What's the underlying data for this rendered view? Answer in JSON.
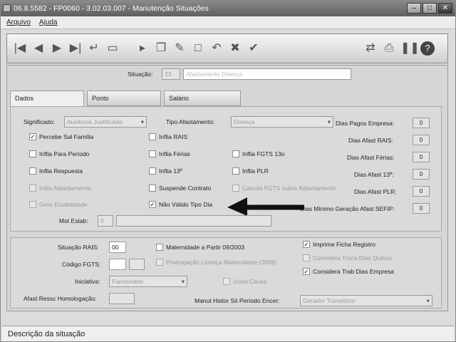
{
  "window": {
    "title": "06.8.5582 - FP0060 - 3.02.03.007 - Manutenção Situações",
    "min": "–",
    "max": "□",
    "close": "✕"
  },
  "menu": {
    "file": "Arquivo",
    "help": "Ajuda"
  },
  "header": {
    "situacao_label": "Situação:",
    "situacao_code": "23",
    "situacao_desc": "Afastamento Doença"
  },
  "tabs": [
    {
      "label": "Dados"
    },
    {
      "label": "Ponto"
    },
    {
      "label": "Salário"
    }
  ],
  "dados": {
    "significado_label": "Significado:",
    "significado_value": "Ausência Justificada",
    "tipo_afast_label": "Tipo Afastamento:",
    "tipo_afast_value": "Doença",
    "dias_pagos_label": "Dias Pagos Empresa:",
    "dias_pagos_value": "0",
    "dias_afast_rais_label": "Dias Afast RAIS:",
    "dias_afast_rais_value": "0",
    "dias_afast_ferias_label": "Dias Afast Férias:",
    "dias_afast_ferias_value": "0",
    "dias_afast_13_label": "Dias Afast 13º:",
    "dias_afast_13_value": "0",
    "dias_afast_plr_label": "Dias Afast PLR:",
    "dias_afast_plr_value": "0",
    "dias_minimo_label": "Dias Mínimo Geração Afast SEFIP:",
    "dias_minimo_value": "0",
    "mot_estab_label": "Mot Estab:",
    "mot_estab_value": "0",
    "checks": {
      "percebe_sal_familia": "Percebe Sal Família",
      "inflia_rais": "Inflia RAIS",
      "inflia_para_periodo": "Inflia Para Período",
      "inflia_ferias": "Inflia Férias",
      "inflia_fgts": "Inflia FGTS 13o",
      "inflia_respuesta": "Inflia Respuesta",
      "inflia_13": "Inflia 13º",
      "inflia_plr": "Inflia PLR",
      "inflia_adiantamento": "Inflia Adiantamento",
      "suspende_contrato": "Suspende Contrato",
      "calcula_fgts": "Calcula FGTS sobre Adiantamento",
      "gera_estabilidade": "Gera Estabilidade",
      "nao_valido": "Não Válido Tipo Dia"
    }
  },
  "bottom": {
    "situacao_rais_label": "Situação RAIS:",
    "situacao_rais_value": "00",
    "codigo_fgts_label": "Código FGTS:",
    "iniciativa_label": "Iniciativa:",
    "iniciativa_value": "Funcionário",
    "afast_ressc_label": "Afast Ressc Homologação:",
    "maternidade": "Maternidade a Partir 09/2003",
    "prorrog": "Prorrogação Licença Maternidade (2009)",
    "justa_causa": "Justa Causa",
    "imprime_ficha": "Imprime Ficha Registro",
    "considera_troc": "Considera Troca Dias Quinze",
    "considera_trab": "Considera Trab Dias Empresa",
    "manut_label": "Manut Histor Sit Período Encer:",
    "manut_value": "Gerador Transitório"
  },
  "status": {
    "text": "Descrição da situação"
  }
}
